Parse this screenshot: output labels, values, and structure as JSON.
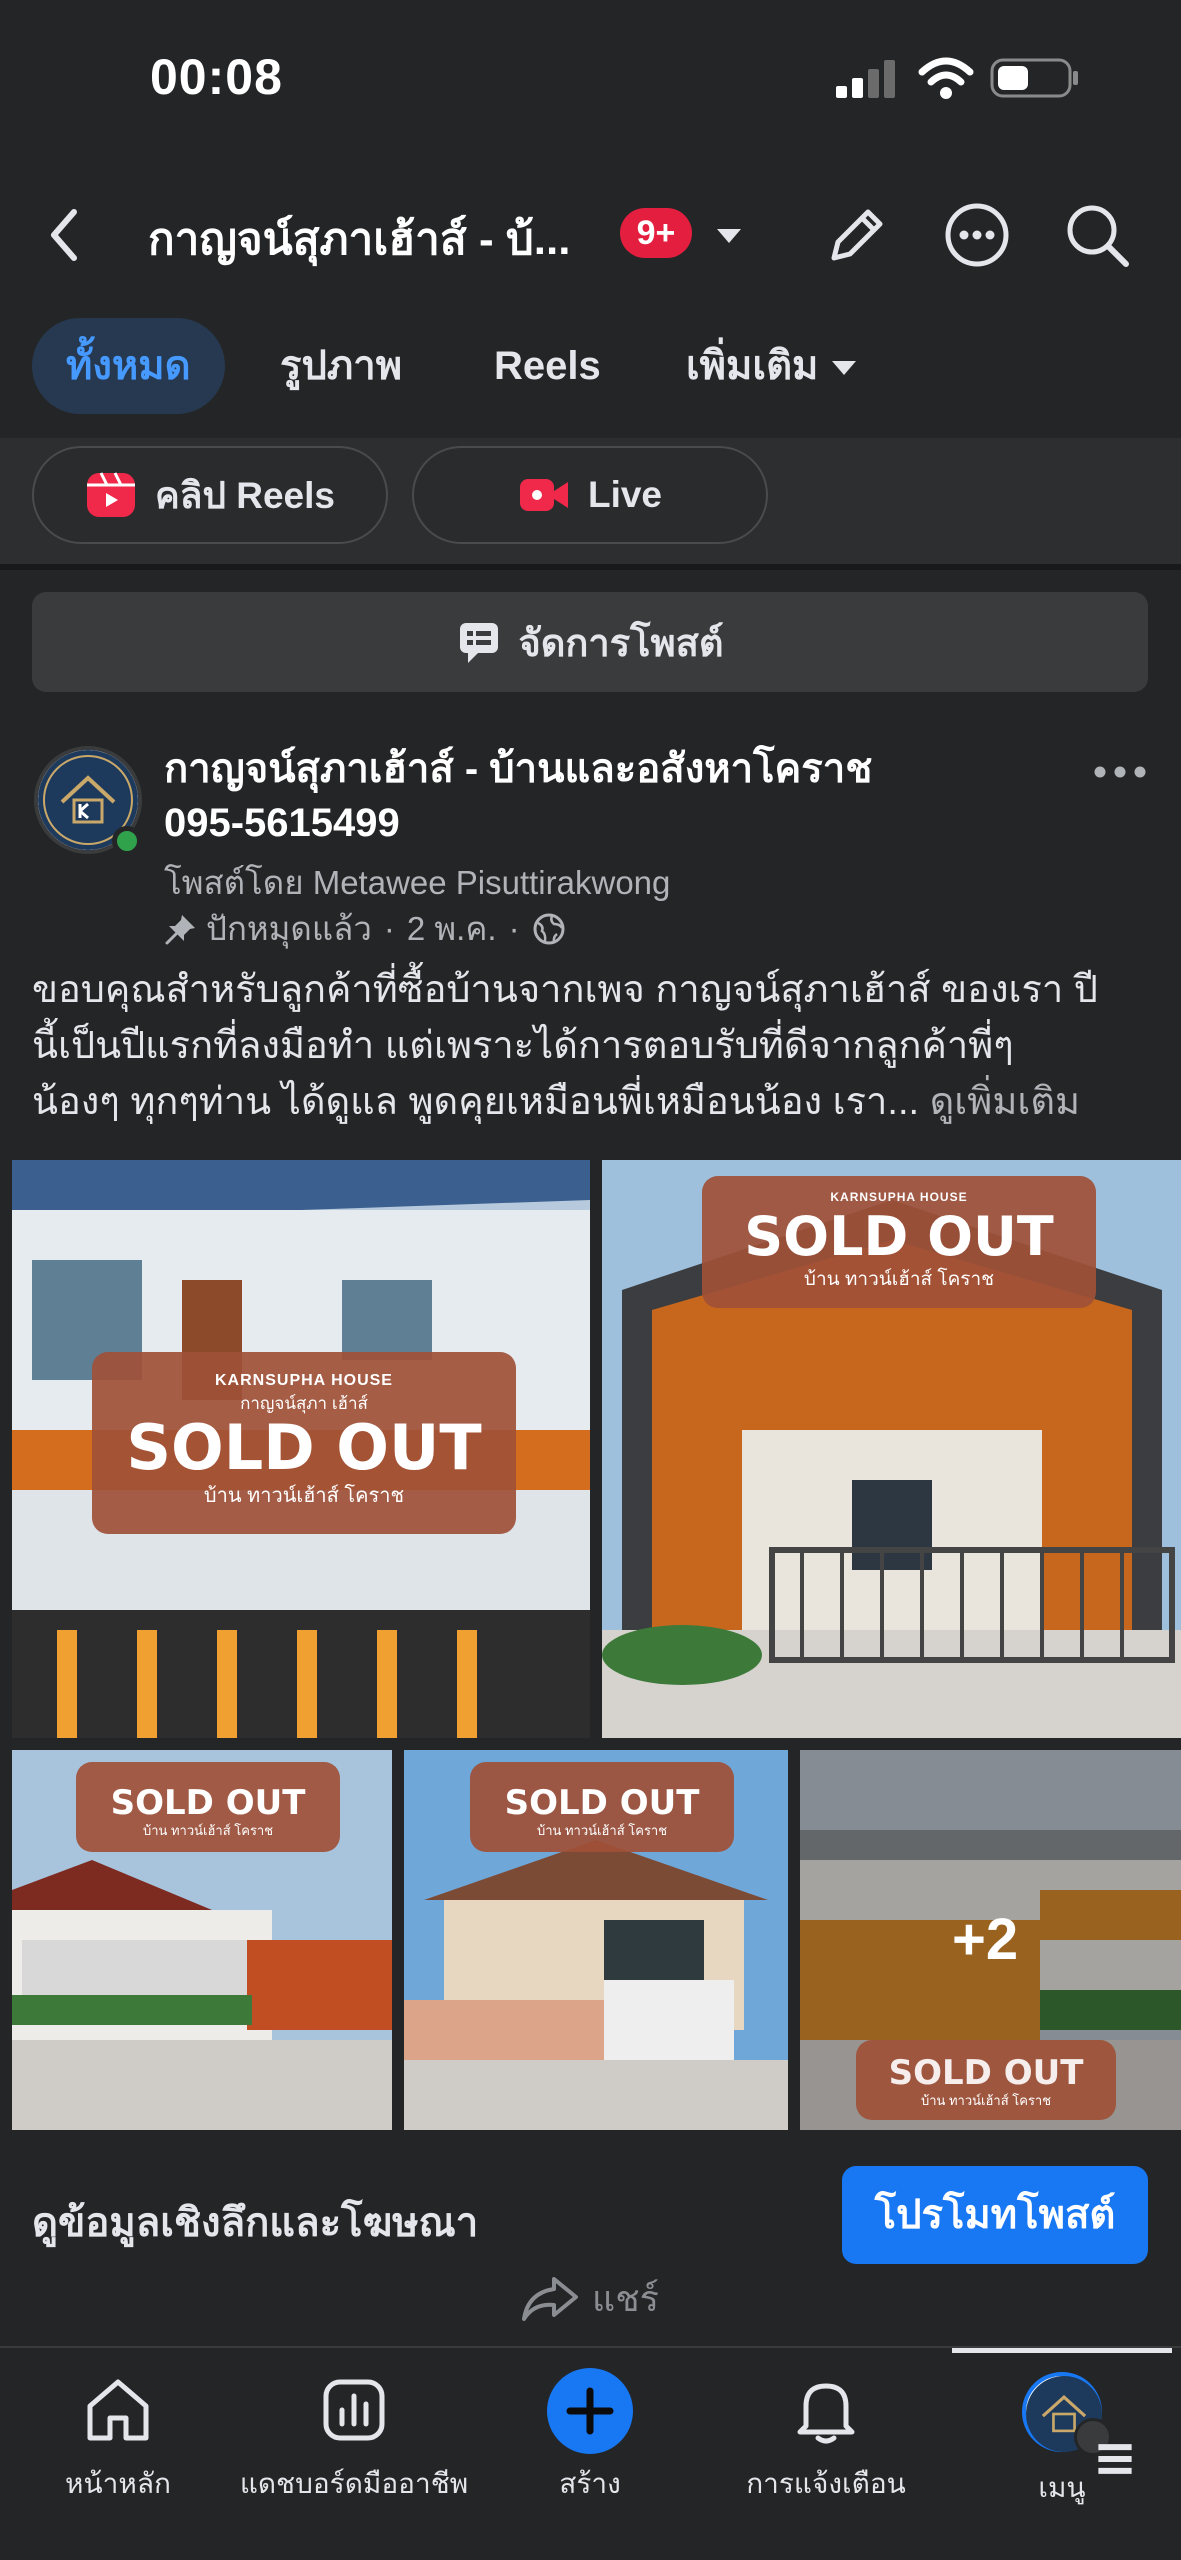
{
  "status_bar": {
    "time": "00:08"
  },
  "header": {
    "title": "กาญจน์สุภาเฮ้าส์ - บ้...",
    "badge": "9+"
  },
  "tabs": [
    {
      "label": "ทั้งหมด",
      "active": true
    },
    {
      "label": "รูปภาพ",
      "active": false
    },
    {
      "label": "Reels",
      "active": false
    },
    {
      "label": "เพิ่มเติม",
      "active": false
    }
  ],
  "chips": [
    {
      "label": "คลิป Reels",
      "icon": "reels-icon"
    },
    {
      "label": "Live",
      "icon": "live-camera-icon"
    }
  ],
  "manage_posts": {
    "label": "จัดการโพสต์"
  },
  "post": {
    "page_name_line1": "กาญจน์สุภาเฮ้าส์ - บ้านและอสังหาโคราช",
    "page_name_line2": "095-5615499",
    "posted_by": "โพสต์โดย Metawee Pisuttirakwong",
    "pinned": "ปักหมุดแล้ว",
    "date": "2 พ.ค.",
    "text_line1": "ขอบคุณสำหรับลูกค้าที่ซื้อบ้านจากเพจ กาญจน์สุภาเฮ้าส์ ของเรา ปี",
    "text_line2": "นี้เป็นปีแรกที่ลงมือทำ แต่เพราะได้การตอบรับที่ดีจากลูกค้าพี่ๆ",
    "text_line3": "น้องๆ ทุกๆท่าน ได้ดูแล พูดคุยเหมือนพี่เหมือนน้อง เรา...",
    "see_more": "ดูเพิ่มเติม",
    "photos": [
      {
        "brand": "KARNSUPHA HOUSE",
        "brand_th": "กาญจน์สุภา เฮ้าส์",
        "title": "SOLD OUT",
        "subtitle": "บ้าน ทาวน์เฮ้าส์ โคราช"
      },
      {
        "brand": "KARNSUPHA HOUSE",
        "title": "SOLD OUT",
        "subtitle": "บ้าน ทาวน์เฮ้าส์ โคราช"
      },
      {
        "title": "SOLD OUT",
        "subtitle": "บ้าน ทาวน์เฮ้าส์ โคราช"
      },
      {
        "title": "SOLD OUT",
        "subtitle": "บ้าน ทาวน์เฮ้าส์ โคราช"
      },
      {
        "title": "SOLD OUT",
        "subtitle": "บ้าน ทาวน์เฮ้าส์ โคราช"
      }
    ],
    "more_photos": "+2"
  },
  "insights": {
    "label": "ดูข้อมูลเชิงลึกและโฆษณา",
    "promote": "โปรโมทโพสต์"
  },
  "share": {
    "label": "แชร์"
  },
  "bottom_nav": [
    {
      "label": "หน้าหลัก",
      "icon": "home-icon"
    },
    {
      "label": "แดชบอร์ดมืออาชีพ",
      "icon": "dashboard-icon"
    },
    {
      "label": "สร้าง",
      "icon": "plus-icon"
    },
    {
      "label": "การแจ้งเตือน",
      "icon": "bell-icon"
    },
    {
      "label": "เมนู",
      "icon": "avatar-menu-icon",
      "active": true
    }
  ],
  "colors": {
    "background": "#242526",
    "accent": "#1877f2",
    "badge": "#e41e3f",
    "sold_card": "#a05037"
  }
}
